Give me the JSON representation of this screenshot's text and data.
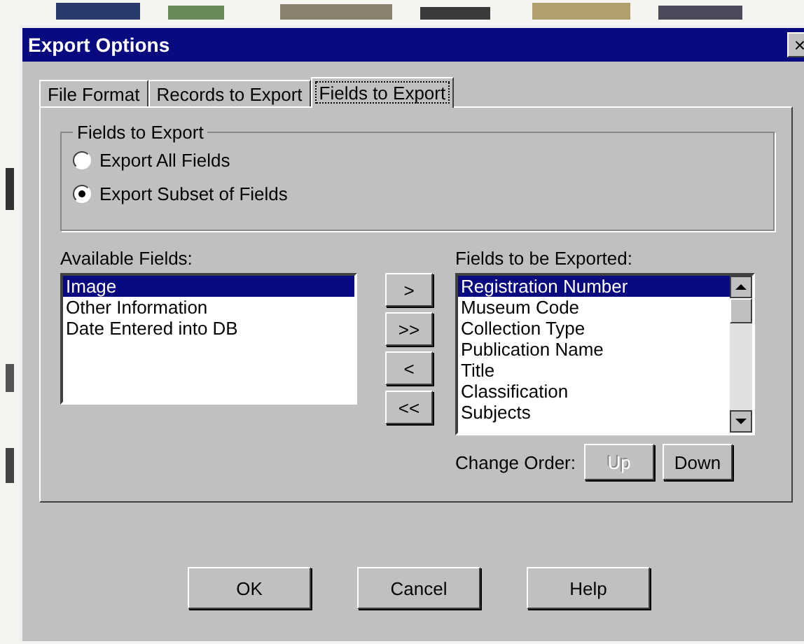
{
  "window": {
    "title": "Export Options",
    "close": "×"
  },
  "tabs": [
    {
      "label": "File Format",
      "selected": false
    },
    {
      "label": "Records to Export",
      "selected": false
    },
    {
      "label": "Fields to Export",
      "selected": true
    }
  ],
  "group": {
    "title": "Fields to Export",
    "options": [
      {
        "label": "Export All Fields",
        "selected": false
      },
      {
        "label": "Export Subset of Fields",
        "selected": true
      }
    ]
  },
  "available": {
    "label": "Available Fields:",
    "items": [
      {
        "label": "Image",
        "selected": true
      },
      {
        "label": "Other Information",
        "selected": false
      },
      {
        "label": "Date Entered into DB",
        "selected": false
      }
    ]
  },
  "move_buttons": [
    ">",
    ">>",
    "<",
    "<<"
  ],
  "exported": {
    "label": "Fields to be Exported:",
    "items": [
      {
        "label": "Registration Number",
        "selected": true
      },
      {
        "label": "Museum Code",
        "selected": false
      },
      {
        "label": "Collection Type",
        "selected": false
      },
      {
        "label": "Publication Name",
        "selected": false
      },
      {
        "label": "Title",
        "selected": false
      },
      {
        "label": "Classification",
        "selected": false
      },
      {
        "label": "Subjects",
        "selected": false
      }
    ]
  },
  "change_order": {
    "label": "Change Order:",
    "buttons": [
      {
        "label": "Up",
        "disabled": true
      },
      {
        "label": "Down",
        "disabled": false
      }
    ]
  },
  "buttons": [
    "OK",
    "Cancel",
    "Help"
  ]
}
